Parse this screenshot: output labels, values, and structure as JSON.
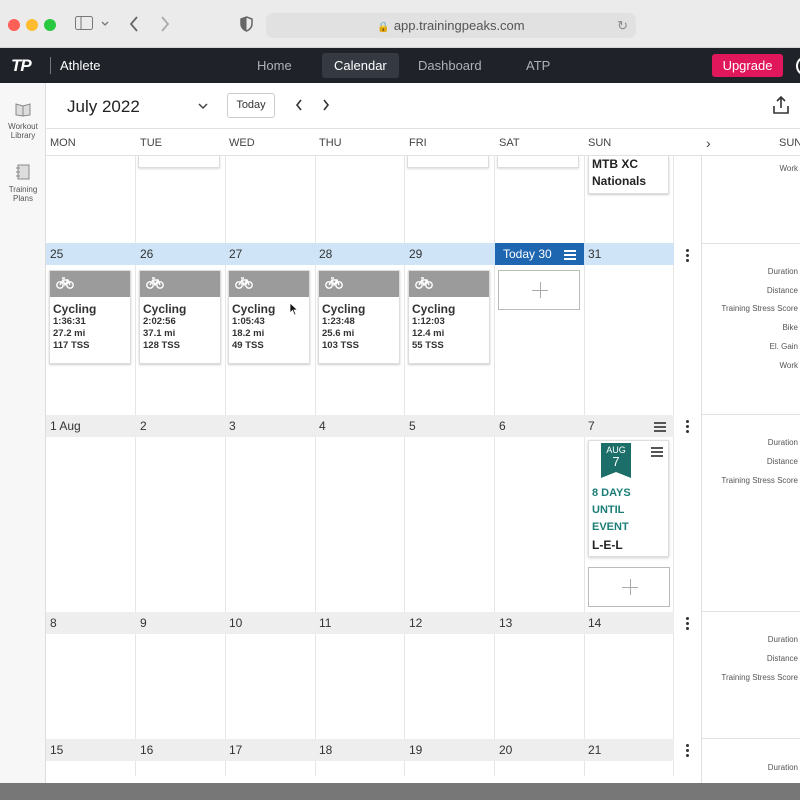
{
  "browser": {
    "url": "app.trainingpeaks.com"
  },
  "header": {
    "logo": "TP",
    "athlete": "Athlete",
    "nav": [
      {
        "label": "Home",
        "active": false
      },
      {
        "label": "Calendar",
        "active": true
      },
      {
        "label": "Dashboard",
        "active": false
      },
      {
        "label": "ATP",
        "active": false
      }
    ],
    "upgrade": "Upgrade",
    "brand_color": "#e0175a"
  },
  "rail": {
    "workout_library": [
      "Workout",
      "Library"
    ],
    "training_plans": [
      "Training",
      "Plans"
    ]
  },
  "calendar": {
    "month": "July 2022",
    "today_button": "Today",
    "weekdays": [
      "MON",
      "TUE",
      "WED",
      "THU",
      "FRI",
      "SAT",
      "SUN"
    ],
    "summary_header": "SUN",
    "top_event": [
      "MTB XC",
      "Nationals"
    ],
    "weeks": [
      {
        "days": [
          "25",
          "26",
          "27",
          "28",
          "29",
          "Today 30",
          "31"
        ]
      },
      {
        "days": [
          "1 Aug",
          "2",
          "3",
          "4",
          "5",
          "6",
          "7"
        ]
      },
      {
        "days": [
          "8",
          "9",
          "10",
          "11",
          "12",
          "13",
          "14"
        ]
      },
      {
        "days": [
          "15",
          "16",
          "17",
          "18",
          "19",
          "20",
          "21"
        ]
      }
    ],
    "workouts": [
      {
        "title": "Cycling",
        "duration": "1:36:31",
        "distance": "27.2 mi",
        "tss": "117 TSS"
      },
      {
        "title": "Cycling",
        "duration": "2:02:56",
        "distance": "37.1 mi",
        "tss": "128 TSS"
      },
      {
        "title": "Cycling",
        "duration": "1:05:43",
        "distance": "18.2 mi",
        "tss": "49 TSS"
      },
      {
        "title": "Cycling",
        "duration": "1:23:48",
        "distance": "25.6 mi",
        "tss": "103 TSS"
      },
      {
        "title": "Cycling",
        "duration": "1:12:03",
        "distance": "12.4 mi",
        "tss": "55 TSS"
      }
    ],
    "event": {
      "flag_month": "AUG",
      "flag_day": "7",
      "countdown": [
        "8 DAYS",
        "UNTIL",
        "EVENT"
      ],
      "name": "L-E-L",
      "color": "#1b6f68"
    }
  },
  "summary": {
    "week0": [
      "Work"
    ],
    "week1": [
      "Duration",
      "Distance",
      "Training Stress Score",
      "Bike",
      "El. Gain",
      "Work"
    ],
    "week2": [
      "Duration",
      "Distance",
      "Training Stress Score"
    ],
    "week3": [
      "Duration",
      "Distance",
      "Training Stress Score"
    ],
    "week4": [
      "Duration"
    ]
  }
}
